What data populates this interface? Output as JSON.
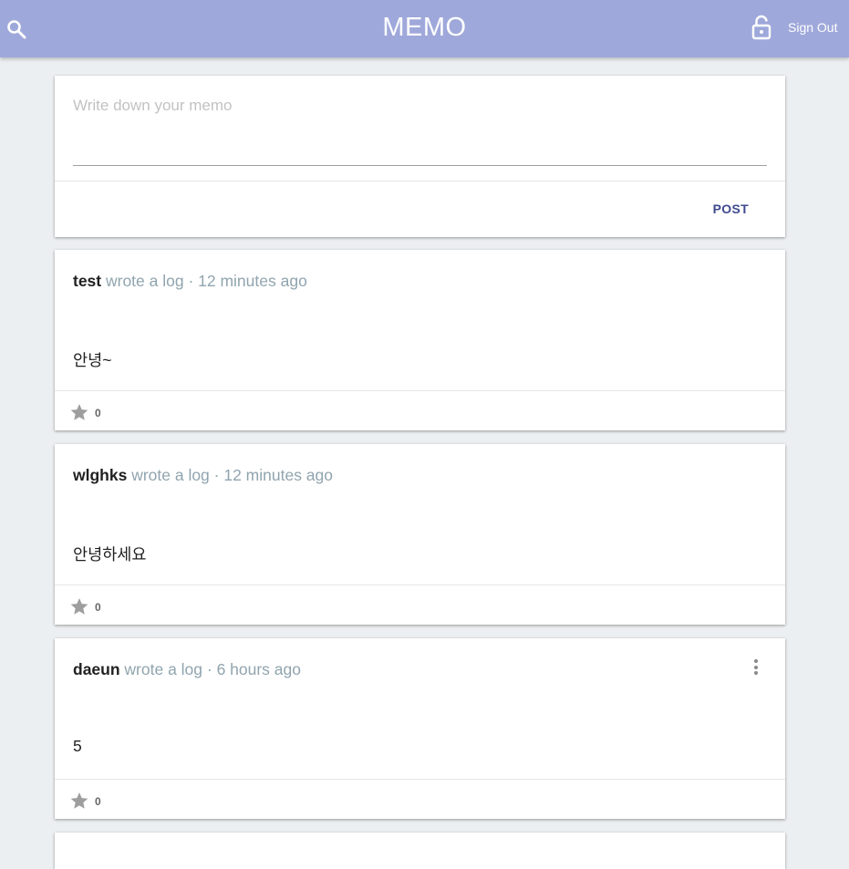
{
  "header": {
    "title": "MEMO",
    "signout_label": "Sign Out",
    "bg_color": "#9fa8da",
    "icons": {
      "left": "search-icon",
      "right": "lock-open-icon"
    }
  },
  "composer": {
    "placeholder": "Write down your memo",
    "value": "",
    "post_label": "POST",
    "post_color": "#3f4a8f"
  },
  "memos": [
    {
      "author": "test",
      "meta": " wrote a log · 12 minutes ago",
      "content": "안녕~",
      "stars": "0",
      "has_menu": false
    },
    {
      "author": "wlghks",
      "meta": " wrote a log · 12 minutes ago",
      "content": "안녕하세요",
      "stars": "0",
      "has_menu": false
    },
    {
      "author": "daeun",
      "meta": " wrote a log · 6 hours ago",
      "content": "5",
      "stars": "0",
      "has_menu": true
    }
  ]
}
